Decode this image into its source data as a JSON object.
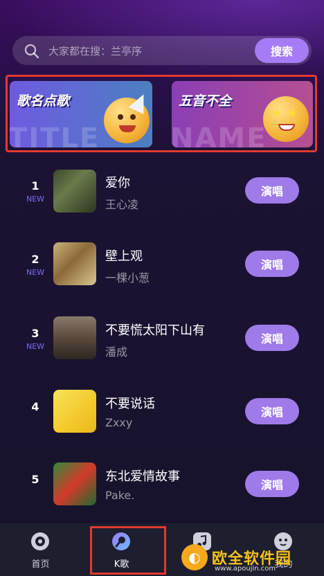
{
  "search": {
    "placeholder": "大家都在搜：兰亭序",
    "button": "搜索"
  },
  "banners": [
    {
      "title": "歌名点歌",
      "bg_text": "TITLE"
    },
    {
      "title": "五音不全",
      "bg_text": "NAME"
    }
  ],
  "songs": [
    {
      "rank": "1",
      "tag": "NEW",
      "title": "爱你",
      "artist": "王心凌",
      "button": "演唱"
    },
    {
      "rank": "2",
      "tag": "NEW",
      "title": "壁上观",
      "artist": "一棵小葱",
      "button": "演唱"
    },
    {
      "rank": "3",
      "tag": "NEW",
      "title": "不要慌太阳下山有",
      "artist": "潘成",
      "button": "演唱"
    },
    {
      "rank": "4",
      "tag": "",
      "title": "不要说话",
      "artist": "Zxxy",
      "button": "演唱"
    },
    {
      "rank": "5",
      "tag": "",
      "title": "东北爱情故事",
      "artist": "Pake.",
      "button": "演唱"
    }
  ],
  "tabs": [
    {
      "label": "首页",
      "icon": "home-disc-icon"
    },
    {
      "label": "K歌",
      "icon": "microphone-icon",
      "selected": true
    },
    {
      "label": "",
      "icon": "music-note-icon"
    },
    {
      "label": "我的",
      "icon": "profile-face-icon"
    }
  ],
  "watermark": {
    "text": "欧全软件园",
    "url": "www.apoujin.com"
  },
  "colors": {
    "accent": "#a67cf6",
    "highlight_border": "#e23b2f",
    "new_tag": "#7a6ff0"
  }
}
